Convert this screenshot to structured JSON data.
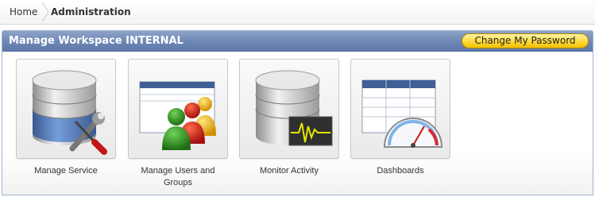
{
  "breadcrumb": {
    "home": "Home",
    "current": "Administration"
  },
  "region": {
    "title": "Manage Workspace INTERNAL",
    "change_password_label": "Change My Password"
  },
  "tiles": [
    {
      "label": "Manage Service",
      "icon": "database-tools-icon"
    },
    {
      "label": "Manage Users and Groups",
      "icon": "users-groups-icon"
    },
    {
      "label": "Monitor Activity",
      "icon": "database-monitor-icon"
    },
    {
      "label": "Dashboards",
      "icon": "dashboard-gauge-icon"
    }
  ],
  "colors": {
    "header": "#6d86b5",
    "button": "#ffd93a"
  }
}
